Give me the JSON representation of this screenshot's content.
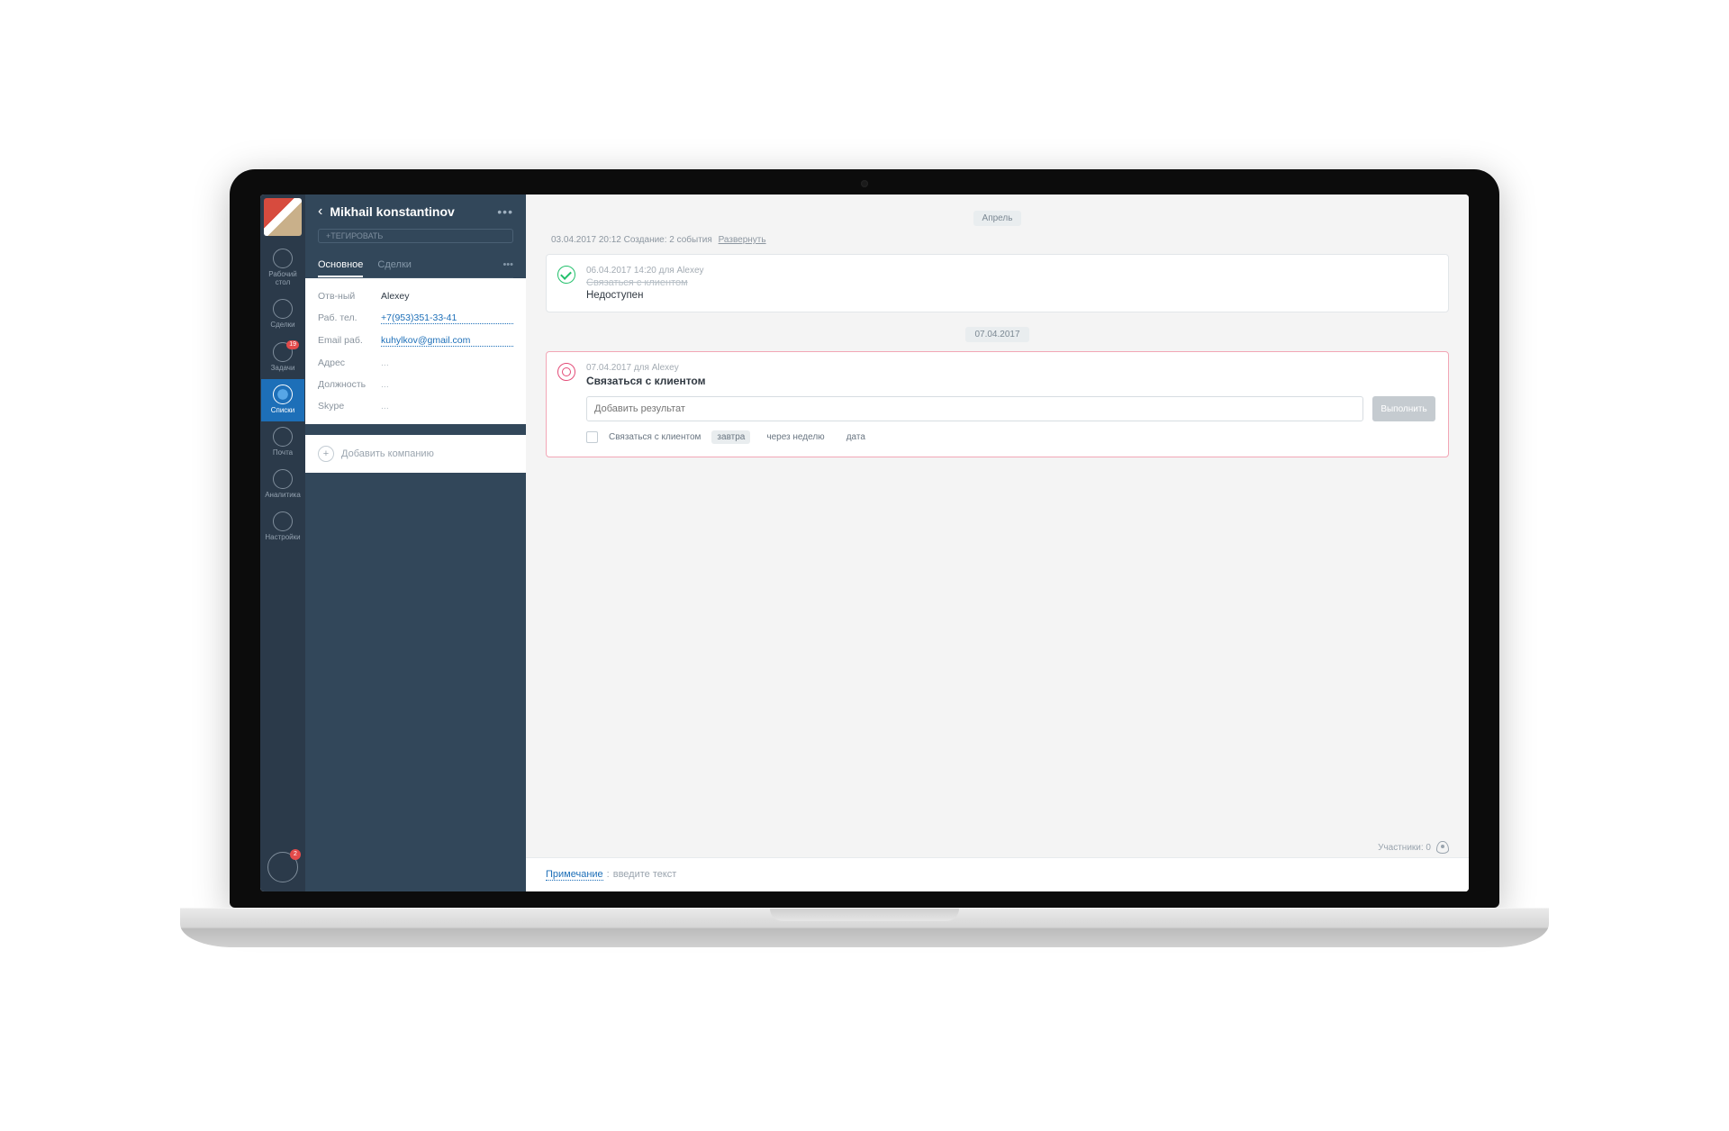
{
  "rail": {
    "items": [
      {
        "label": "Рабочий\nстол"
      },
      {
        "label": "Сделки"
      },
      {
        "label": "Задачи",
        "badge": "19"
      },
      {
        "label": "Списки"
      },
      {
        "label": "Почта"
      },
      {
        "label": "Аналитика"
      },
      {
        "label": "Настройки"
      }
    ],
    "bottom_badge": "2"
  },
  "panel": {
    "name": "Mikhail konstantinov",
    "tag": "+ТЕГИРОВАТЬ",
    "tabs": {
      "main": "Основное",
      "deals": "Сделки"
    },
    "fields": [
      {
        "label": "Отв-ный",
        "value": "Alexey",
        "kind": "text"
      },
      {
        "label": "Раб. тел.",
        "value": "+7(953)351-33-41",
        "kind": "link"
      },
      {
        "label": "Email раб.",
        "value": "kuhylkov@gmail.com",
        "kind": "link"
      },
      {
        "label": "Адрес",
        "value": "...",
        "kind": "muted"
      },
      {
        "label": "Должность",
        "value": "...",
        "kind": "muted"
      },
      {
        "label": "Skype",
        "value": "...",
        "kind": "muted"
      }
    ],
    "add_company": "Добавить компанию"
  },
  "timeline": {
    "month": "Апрель",
    "log": {
      "stamp": "03.04.2017 20:12 Создание: 2 события",
      "expand": "Развернуть"
    },
    "done": {
      "meta": "06.04.2017 14:20 для Alexey",
      "strike": "Связаться с клиентом",
      "status": "Недоступен"
    },
    "date_pill": "07.04.2017",
    "task": {
      "meta": "07.04.2017 для Alexey",
      "title": "Связаться с клиентом",
      "placeholder": "Добавить результат",
      "button": "Выполнить",
      "checkbox_label": "Связаться с клиентом",
      "opts": [
        "завтра",
        "через неделю",
        "дата"
      ]
    }
  },
  "footer": {
    "participants_label": "Участники: 0",
    "note_label": "Примечание",
    "note_placeholder": "введите текст"
  }
}
